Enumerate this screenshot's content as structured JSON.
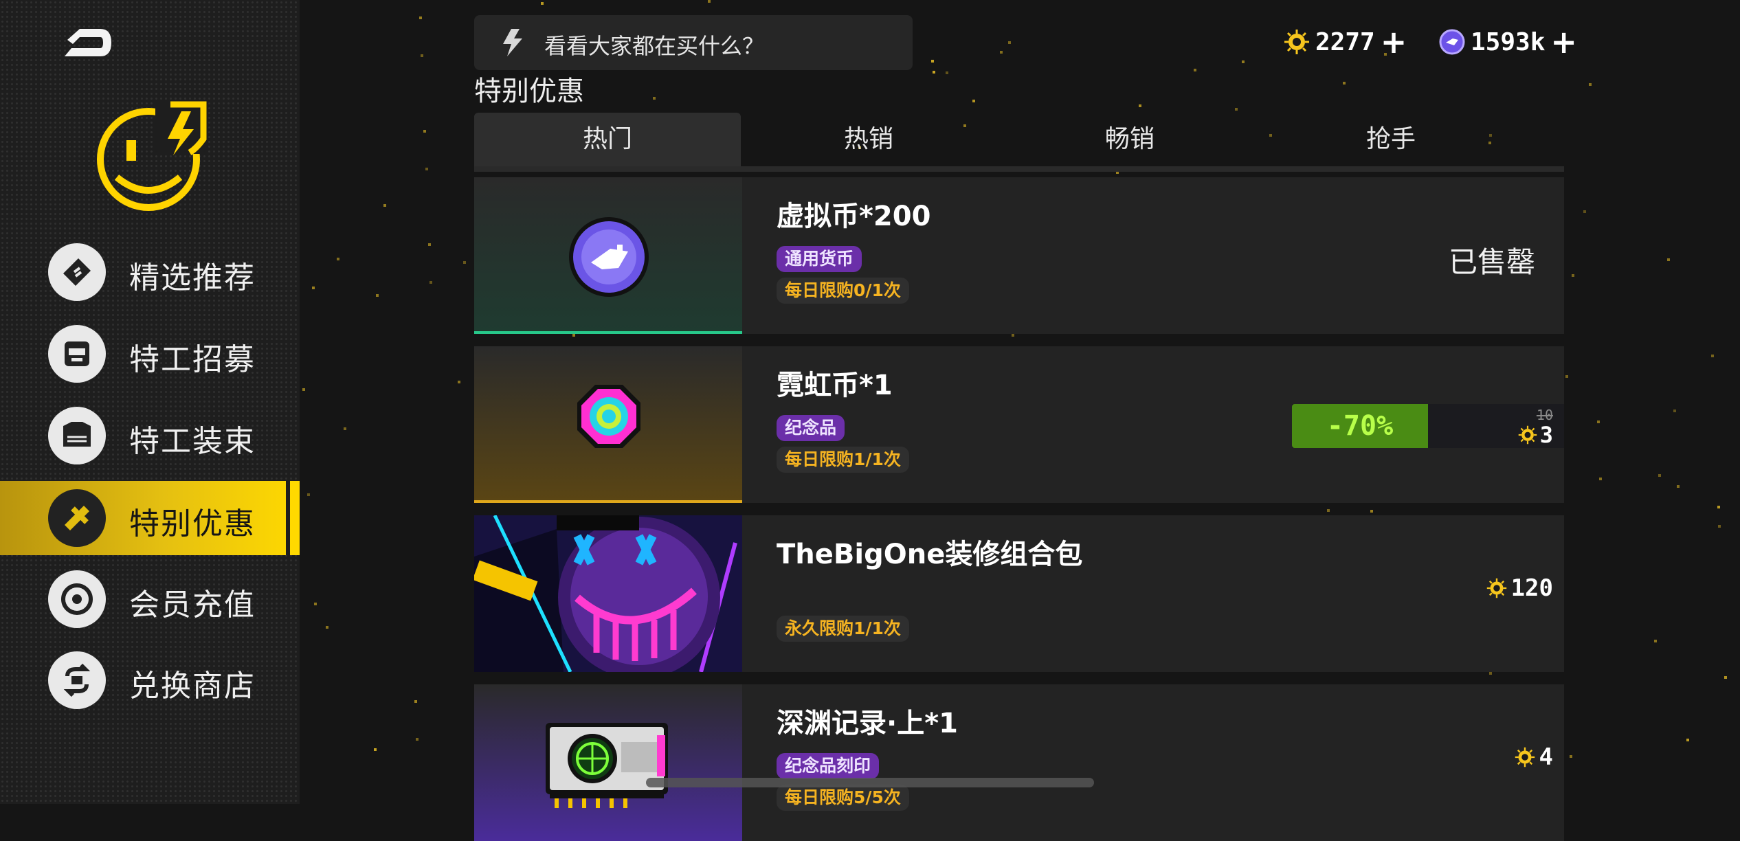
{
  "sidebar": {
    "items": [
      {
        "label": "精选推荐",
        "icon": "ticket-icon"
      },
      {
        "label": "特工招募",
        "icon": "agent-face-icon"
      },
      {
        "label": "特工装束",
        "icon": "outfit-icon"
      },
      {
        "label": "特别优惠",
        "icon": "special-offer-icon",
        "active": true
      },
      {
        "label": "会员充值",
        "icon": "membership-icon"
      },
      {
        "label": "兑换商店",
        "icon": "exchange-icon"
      }
    ]
  },
  "header": {
    "search_text": "看看大家都在买什么？",
    "currency1": {
      "value": "2277",
      "icon": "gold-coin-icon"
    },
    "currency2": {
      "value": "1593k",
      "icon": "virtual-coin-icon"
    }
  },
  "section_title": "特别优惠",
  "tabs": [
    {
      "label": "热门",
      "active": true
    },
    {
      "label": "热销"
    },
    {
      "label": "畅销"
    },
    {
      "label": "抢手"
    }
  ],
  "items": [
    {
      "name": "虚拟币*200",
      "tag": "通用货币",
      "limit": "每日限购0/1次",
      "status": "已售罄"
    },
    {
      "name": "霓虹币*1",
      "tag": "纪念品",
      "limit": "每日限购1/1次",
      "discount": "-70%",
      "original_price": "10",
      "price": "3"
    },
    {
      "name": "TheBigOne装修组合包",
      "limit": "永久限购1/1次",
      "price": "120"
    },
    {
      "name": "深渊记录·上*1",
      "tag": "纪念品刻印",
      "limit": "每日限购5/5次",
      "price": "4"
    }
  ],
  "colors": {
    "accent": "#ffd900",
    "tag_purple": "#6b2fa9",
    "limit_text": "#f5b321",
    "discount_green": "#4a8c14"
  }
}
